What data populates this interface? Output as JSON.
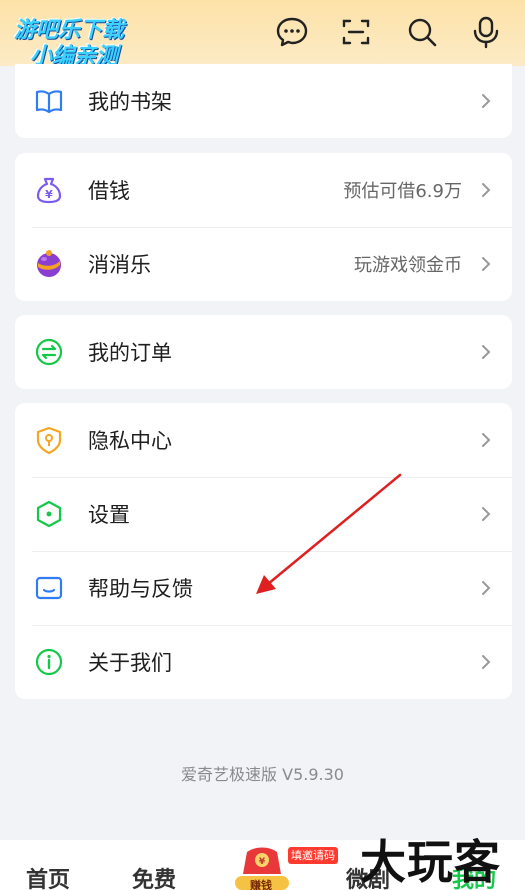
{
  "header": {
    "watermark_line1": "游吧乐下载",
    "watermark_line2": "小编亲测",
    "icons": [
      "message-icon",
      "scan-icon",
      "search-icon",
      "microphone-icon"
    ]
  },
  "menu": {
    "bookshelf": {
      "label": "我的书架"
    },
    "borrow": {
      "label": "借钱",
      "value": "预估可借6.9万"
    },
    "game": {
      "label": "消消乐",
      "value": "玩游戏领金币"
    },
    "orders": {
      "label": "我的订单"
    },
    "privacy": {
      "label": "隐私中心"
    },
    "settings": {
      "label": "设置"
    },
    "help": {
      "label": "帮助与反馈"
    },
    "about": {
      "label": "关于我们"
    }
  },
  "version": "爱奇艺极速版 V5.9.30",
  "nav": {
    "home": "首页",
    "free": "免费",
    "promo_badge": "填邀请码",
    "promo_label": "赚钱",
    "shorts": "微剧",
    "mine": "我的"
  },
  "watermark_big": "大玩客",
  "colors": {
    "accent": "#14c84a",
    "header_bg": "#fde2a8",
    "annotation_arrow": "#e02020"
  }
}
